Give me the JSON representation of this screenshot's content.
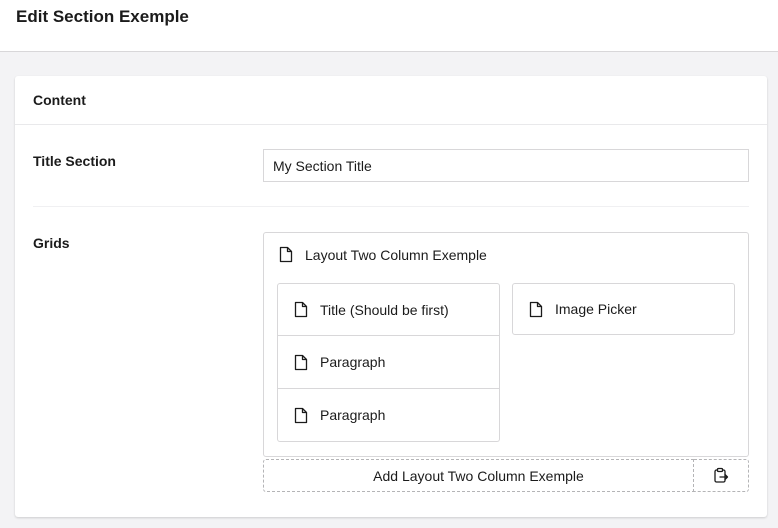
{
  "header": {
    "title": "Edit Section Exemple"
  },
  "panel": {
    "title": "Content",
    "properties": {
      "title_section": {
        "label": "Title Section",
        "value": "My Section Title"
      },
      "grids": {
        "label": "Grids"
      }
    }
  },
  "grid": {
    "layout_name": "Layout Two Column Exemple",
    "column_left": [
      {
        "label": "Title (Should be first)",
        "icon": "document-icon"
      },
      {
        "label": "Paragraph",
        "icon": "document-icon"
      },
      {
        "label": "Paragraph",
        "icon": "document-icon"
      }
    ],
    "column_right": [
      {
        "label": "Image Picker",
        "icon": "document-icon"
      }
    ],
    "add_button_label": "Add Layout Two Column Exemple",
    "paste_icon": "clipboard-paste-icon"
  }
}
